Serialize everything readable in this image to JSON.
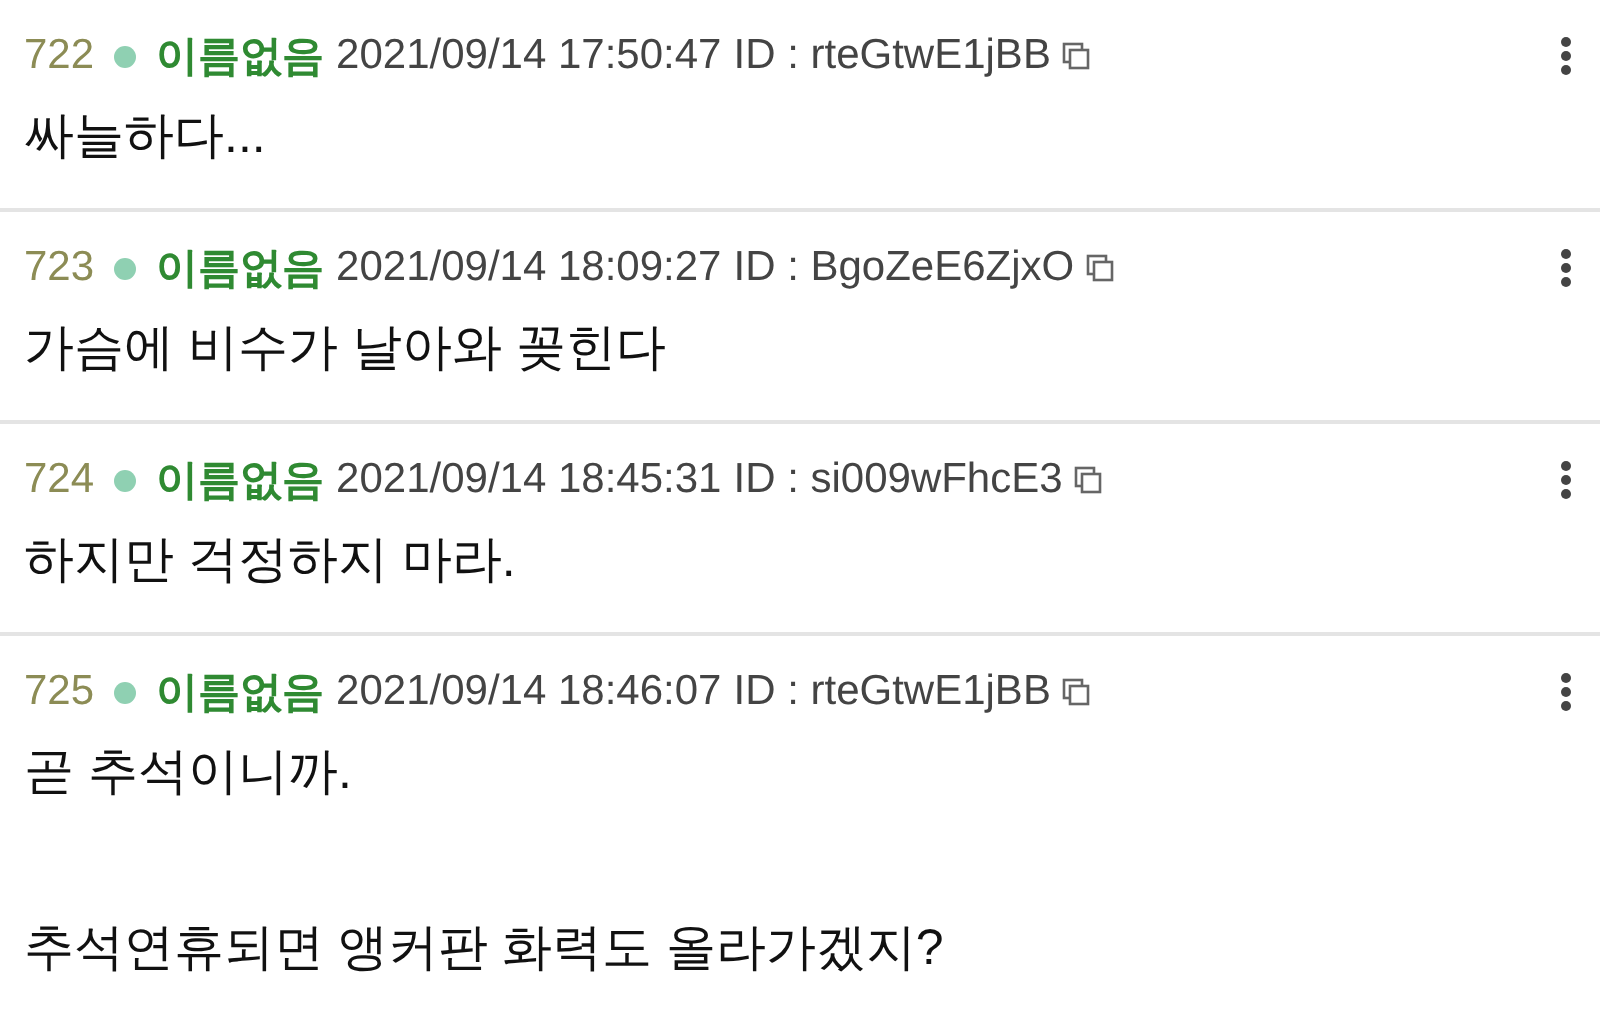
{
  "posts": [
    {
      "number": "722",
      "name": "이름없음",
      "date": "2021/09/14 17:50:47",
      "id": "ID : rteGtwE1jBB",
      "paragraphs": [
        "싸늘하다..."
      ]
    },
    {
      "number": "723",
      "name": "이름없음",
      "date": "2021/09/14 18:09:27",
      "id": "ID : BgoZeE6ZjxO",
      "paragraphs": [
        "가슴에 비수가 날아와 꽂힌다"
      ]
    },
    {
      "number": "724",
      "name": "이름없음",
      "date": "2021/09/14 18:45:31",
      "id": "ID : si009wFhcE3",
      "paragraphs": [
        "하지만 걱정하지 마라."
      ]
    },
    {
      "number": "725",
      "name": "이름없음",
      "date": "2021/09/14 18:46:07",
      "id": "ID : rteGtwE1jBB",
      "paragraphs": [
        "곧 추석이니까.",
        "추석연휴되면 앵커판 화력도 올라가겠지?"
      ]
    }
  ]
}
